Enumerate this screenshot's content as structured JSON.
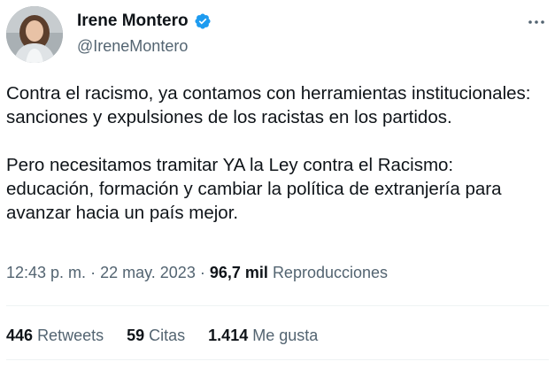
{
  "author": {
    "display_name": "Irene Montero",
    "handle": "@IreneMontero",
    "verified_color": "#1d9bf0"
  },
  "tweet": {
    "paragraphs": [
      "Contra el racismo, ya contamos con herramientas institucionales: sanciones y expulsiones de los racistas en los partidos.",
      "Pero necesitamos tramitar YA la Ley contra el Racismo: educación, formación y cambiar la política de extranjería para avanzar hacia un país mejor."
    ]
  },
  "meta": {
    "time": "12:43 p. m.",
    "separator": "·",
    "date": "22 may. 2023",
    "views_count": "96,7 mil",
    "views_label": "Reproducciones"
  },
  "stats": {
    "retweets_count": "446",
    "retweets_label": "Retweets",
    "quotes_count": "59",
    "quotes_label": "Citas",
    "likes_count": "1.414",
    "likes_label": "Me gusta"
  },
  "icons": {
    "verified": "verified-badge-icon",
    "more": "more-options-icon"
  }
}
